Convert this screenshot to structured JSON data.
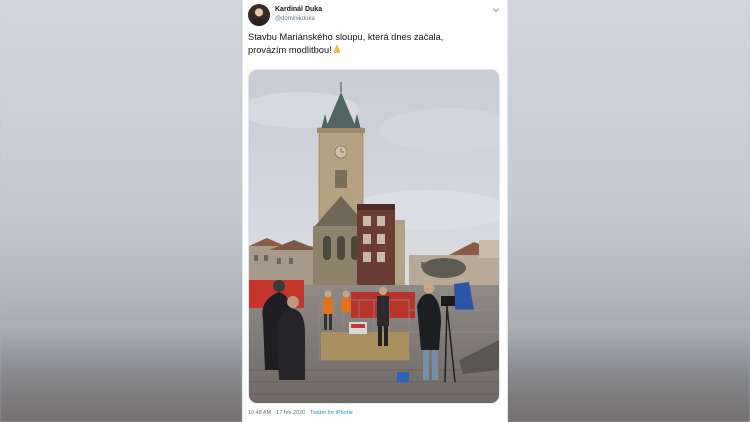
{
  "tweet": {
    "author_name": "Kardinál Duka",
    "author_handle": "@dominikduka",
    "text_line1": "Stavbu Mariánského sloupu, která dnes začala,",
    "text_line2": "provázím modlitbou!",
    "emoji_icon": "folded-hands-icon",
    "time": "10:48 AM",
    "separator": "·",
    "date": "17 feb 2020",
    "source_separator": "·",
    "source": "Twitter for iPhone"
  },
  "colors": {
    "link": "#1b95e0",
    "text": "#14171a",
    "muted": "#657786"
  }
}
